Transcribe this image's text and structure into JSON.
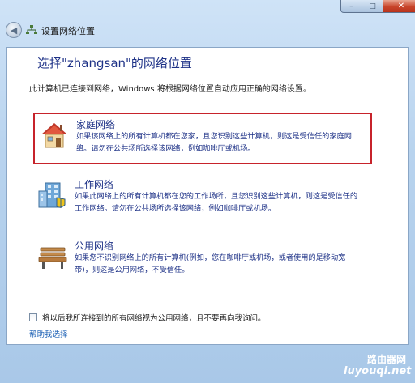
{
  "window": {
    "title": "设置网络位置",
    "controls": {
      "minimize": "–",
      "maximize": "□",
      "close": "✕"
    }
  },
  "content": {
    "heading": "选择\"zhangsan\"的网络位置",
    "intro": "此计算机已连接到网络，Windows 将根据网络位置自动应用正确的网络设置。",
    "options": [
      {
        "title": "家庭网络",
        "description": "如果该网络上的所有计算机都在您家，且您识别这些计算机，则这是受信任的家庭网络。请勿在公共场所选择该网络，例如咖啡厅或机场。",
        "icon": "house-icon",
        "selected": true
      },
      {
        "title": "工作网络",
        "description": "如果此网络上的所有计算机都在您的工作场所，且您识别这些计算机，则这是受信任的工作网络。请勿在公共场所选择该网络，例如咖啡厅或机场。",
        "icon": "office-building-icon",
        "selected": false
      },
      {
        "title": "公用网络",
        "description": "如果您不识别网络上的所有计算机(例如，您在咖啡厅或机场，或者使用的是移动宽带)，则这是公用网络，不受信任。",
        "icon": "park-bench-icon",
        "selected": false
      }
    ],
    "checkbox_label": "将以后我所连接到的所有网络视为公用网络，且不要再向我询问。",
    "checkbox_checked": false,
    "help_link": "帮助我选择"
  },
  "watermark": {
    "line1": "路由器网",
    "line2": "luyouqi.net"
  },
  "colors": {
    "accent_text": "#1e3287",
    "selection_border": "#c7232b",
    "link": "#1a5fb4"
  }
}
